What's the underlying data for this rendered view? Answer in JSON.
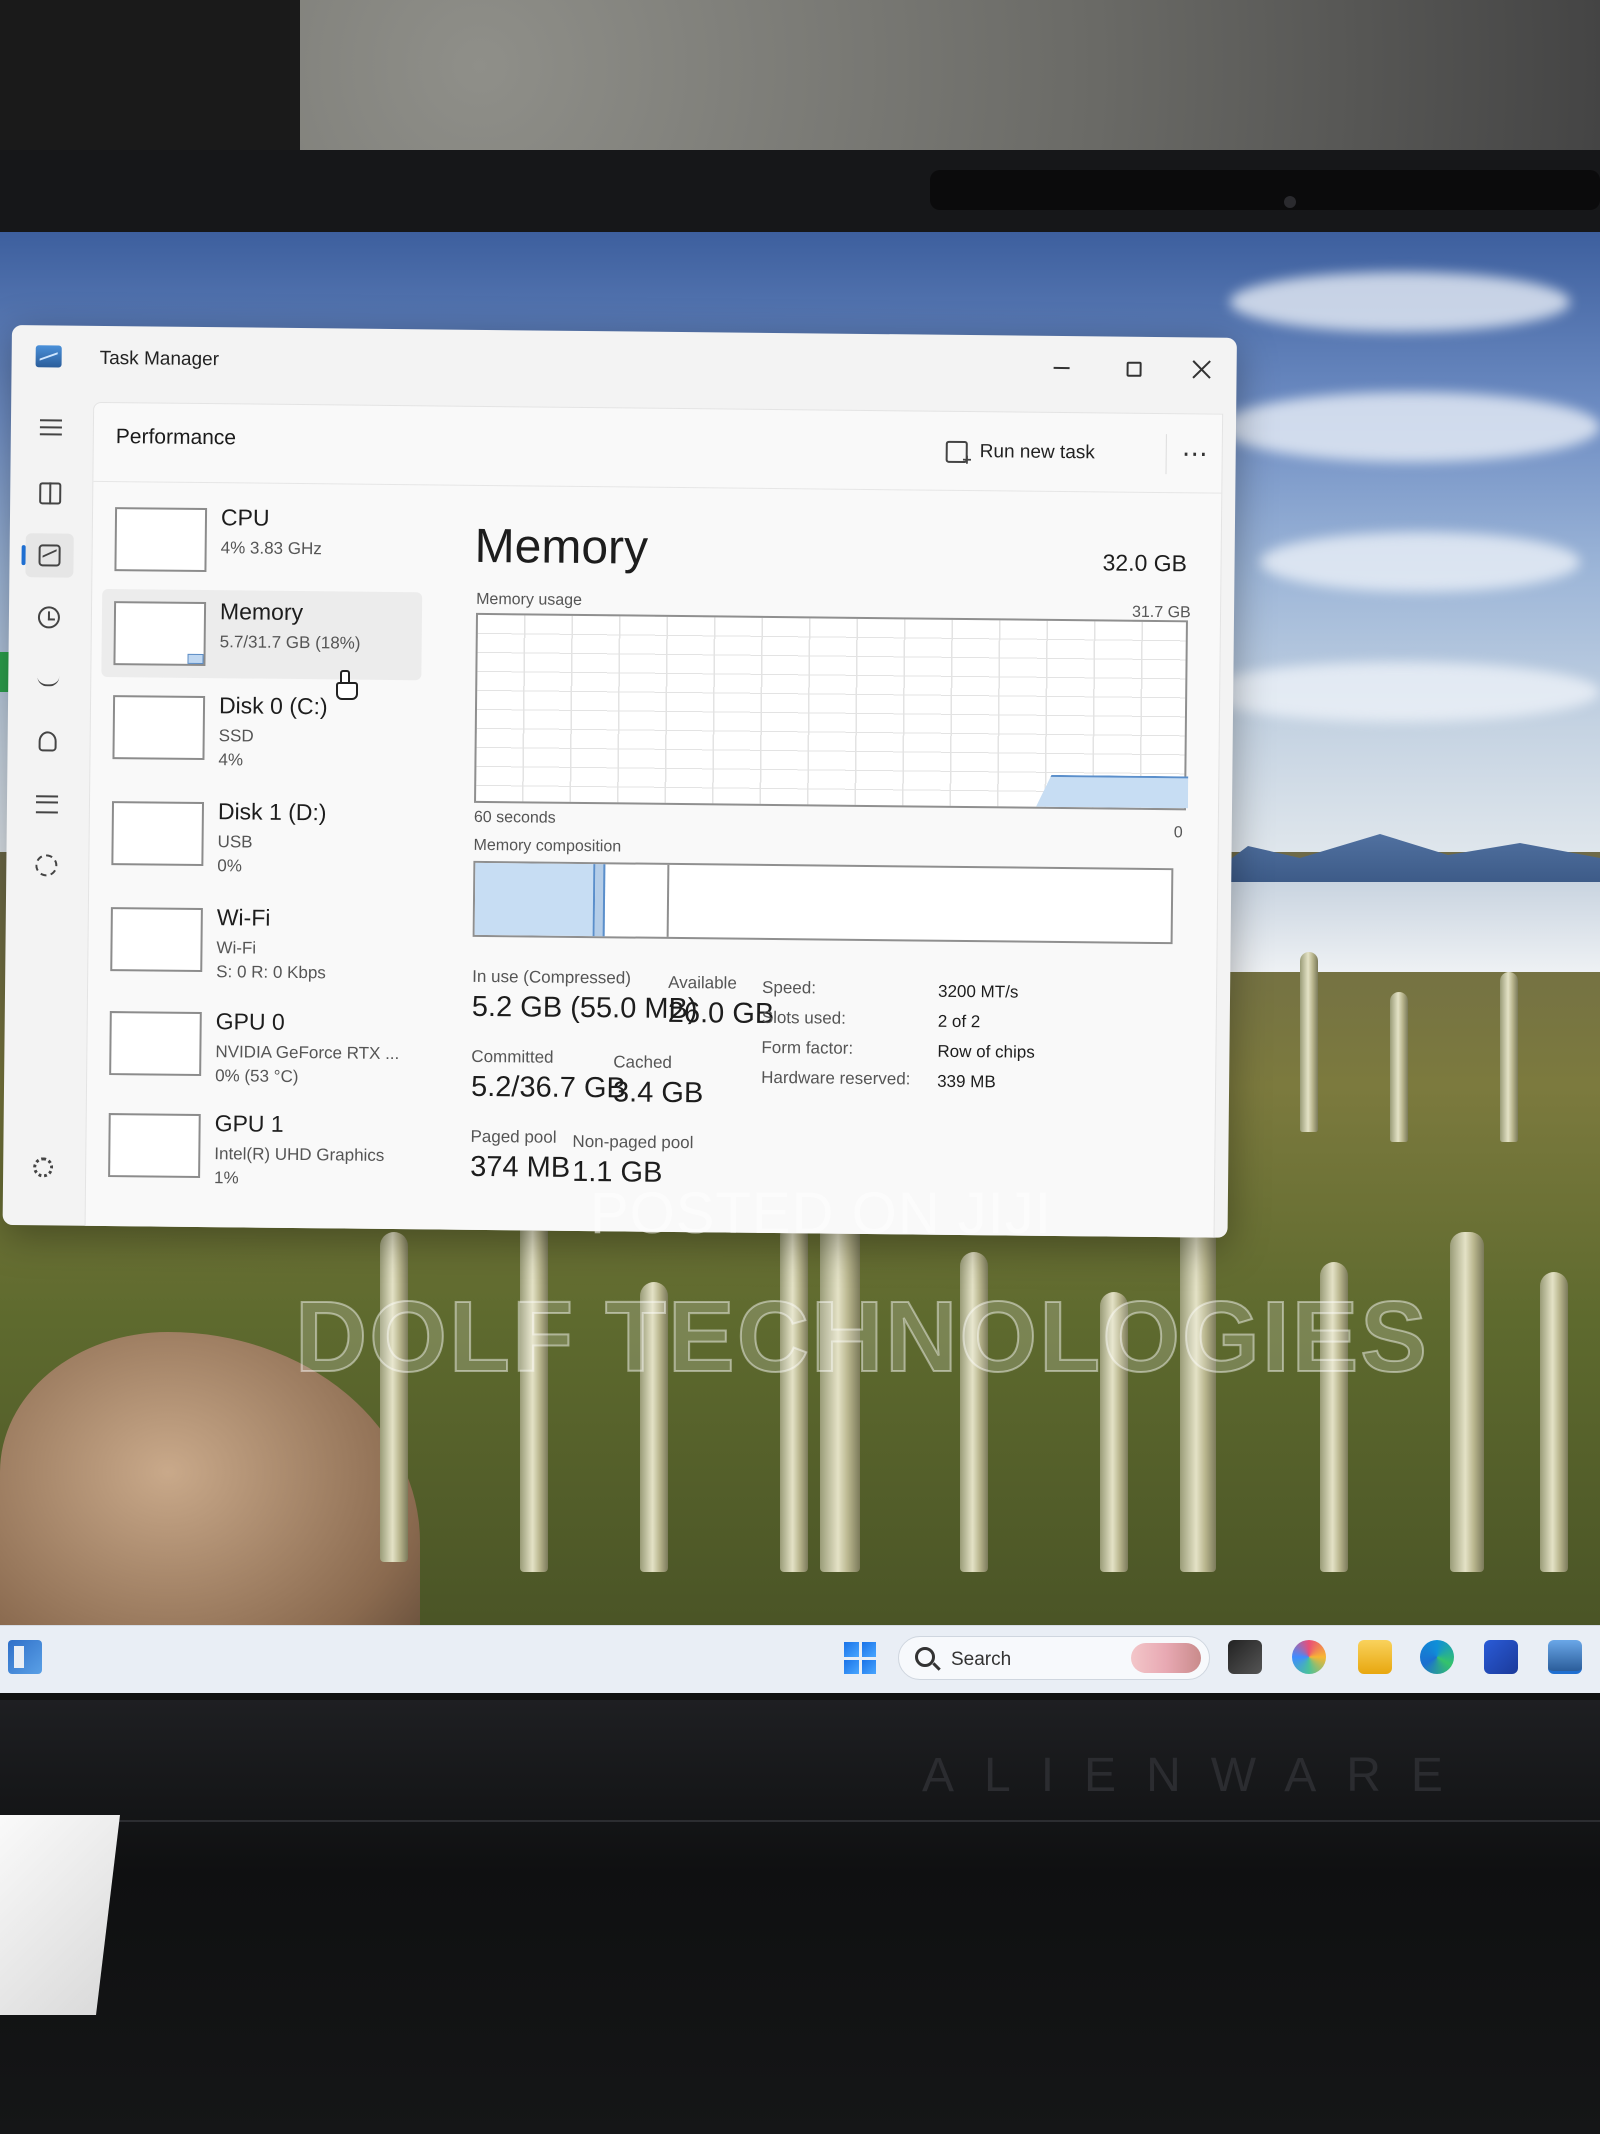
{
  "window": {
    "title": "Task Manager"
  },
  "header": {
    "page_title": "Performance",
    "run_new_task": "Run new task",
    "more": "⋯"
  },
  "resources": [
    {
      "name": "CPU",
      "line1": "4%  3.83 GHz",
      "line2": ""
    },
    {
      "name": "Memory",
      "line1": "5.7/31.7 GB (18%)",
      "line2": ""
    },
    {
      "name": "Disk 0 (C:)",
      "line1": "SSD",
      "line2": "4%"
    },
    {
      "name": "Disk 1 (D:)",
      "line1": "USB",
      "line2": "0%"
    },
    {
      "name": "Wi-Fi",
      "line1": "Wi-Fi",
      "line2": "S: 0  R: 0 Kbps"
    },
    {
      "name": "GPU 0",
      "line1": "NVIDIA GeForce RTX ...",
      "line2": "0%  (53 °C)"
    },
    {
      "name": "GPU 1",
      "line1": "Intel(R) UHD Graphics",
      "line2": "1%"
    }
  ],
  "memory": {
    "title": "Memory",
    "total": "32.0 GB",
    "usage_label": "Memory usage",
    "usage_max": "31.7 GB",
    "x_left": "60 seconds",
    "x_right": "0",
    "composition_label": "Memory composition",
    "in_use_label": "In use (Compressed)",
    "in_use_value": "5.2 GB (55.0 MB)",
    "available_label": "Available",
    "available_value": "26.0 GB",
    "committed_label": "Committed",
    "committed_value": "5.2/36.7 GB",
    "cached_label": "Cached",
    "cached_value": "3.4 GB",
    "paged_label": "Paged pool",
    "paged_value": "374 MB",
    "nonpaged_label": "Non-paged pool",
    "nonpaged_value": "1.1 GB",
    "specs": [
      {
        "key": "Speed:",
        "value": "3200 MT/s"
      },
      {
        "key": "Slots used:",
        "value": "2 of 2"
      },
      {
        "key": "Form factor:",
        "value": "Row of chips"
      },
      {
        "key": "Hardware reserved:",
        "value": "339 MB"
      }
    ]
  },
  "taskbar": {
    "search_label": "Search"
  },
  "watermarks": {
    "posted": "POSTED ON JIJI",
    "seller": "DOLF TECHNOLOGIES"
  },
  "device": {
    "brand": "ALIENWARE"
  },
  "colors": {
    "accent": "#1f6fd1",
    "graph_fill": "#c7ddf3",
    "graph_line": "#5b8fcb"
  }
}
